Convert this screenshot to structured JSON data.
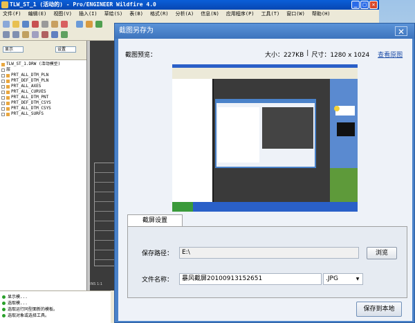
{
  "app": {
    "title": "TLW_ST_1 (活动的) - Pro/ENGINEER Wildfire 4.0",
    "menu": [
      "文件(F)",
      "编辑(E)",
      "视图(V)",
      "插入(I)",
      "草绘(S)",
      "表(B)",
      "格式(R)",
      "分析(A)",
      "信息(N)",
      "应用程序(P)",
      "工具(T)",
      "窗口(W)",
      "帮助(H)"
    ],
    "left_controls": [
      "显示",
      "设置"
    ],
    "tree_root": "TLW_ST_1.DRW (活动模型)",
    "tree_sub": "层",
    "tree_items": [
      "PRT_ALL_DTM_PLN",
      "PRT_DEF_DTM_PLN",
      "PRT_ALL_AXES",
      "PRT_ALL_CURVES",
      "PRT_ALL_DTM_PNT",
      "PRT_DEF_DTM_CSYS",
      "PRT_ALL_DTM_CSYS",
      "PRT_ALL_SURFS"
    ],
    "status_lines": [
      "显示模...",
      "选取模...",
      "选取运行同型面新的模板。",
      "选取对象或选择工具。"
    ],
    "canvas_status": "INS 1:1"
  },
  "dialog": {
    "title": "截图另存为",
    "close": "✕",
    "preview_label": "截图预览：",
    "size_label": "大小：227KB",
    "dimensions_label": "尺寸：1280 x 1024",
    "view_original": "查看原图",
    "tab": "截屏设置",
    "path_label": "保存路径：",
    "path_value": "E:\\",
    "browse_button": "浏览",
    "filename_label": "文件名称：",
    "filename_value": "暴风截屏20100913152651",
    "format_value": ".JPG",
    "save_button": "保存到本地"
  },
  "colors": {
    "dialog_frame": "#4a82c9",
    "dialog_body": "#eef2f8",
    "link": "#1f4fa8"
  }
}
